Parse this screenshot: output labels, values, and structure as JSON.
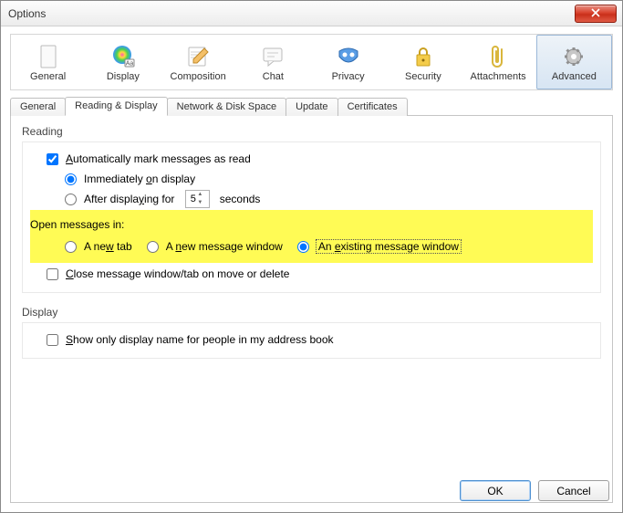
{
  "title": "Options",
  "categories": [
    {
      "label": "General"
    },
    {
      "label": "Display"
    },
    {
      "label": "Composition"
    },
    {
      "label": "Chat"
    },
    {
      "label": "Privacy"
    },
    {
      "label": "Security"
    },
    {
      "label": "Attachments"
    },
    {
      "label": "Advanced"
    }
  ],
  "subtabs": [
    {
      "label": "General"
    },
    {
      "label": "Reading & Display"
    },
    {
      "label": "Network & Disk Space"
    },
    {
      "label": "Update"
    },
    {
      "label": "Certificates"
    }
  ],
  "reading": {
    "title": "Reading",
    "auto_mark": "Automatically mark messages as read",
    "immediately_pre": "Immediately ",
    "immediately_u": "o",
    "immediately_post": "n display",
    "after_pre": "After displa",
    "after_u": "y",
    "after_post": "ing for",
    "after_value": "5",
    "seconds": "seconds",
    "open_in": "Open messages in:",
    "opt1_pre": "A ne",
    "opt1_u": "w",
    "opt1_post": " tab",
    "opt2_pre": "A ",
    "opt2_u": "n",
    "opt2_post": "ew message window",
    "opt3_pre": "An ",
    "opt3_u": "e",
    "opt3_post": "xisting message window",
    "close_pre": "",
    "close_u": "C",
    "close_post": "lose message window/tab on move or delete"
  },
  "display": {
    "title": "Display",
    "showonly_pre": "",
    "showonly_u": "S",
    "showonly_post": "how only display name for people in my address book"
  },
  "buttons": {
    "ok": "OK",
    "cancel": "Cancel"
  }
}
